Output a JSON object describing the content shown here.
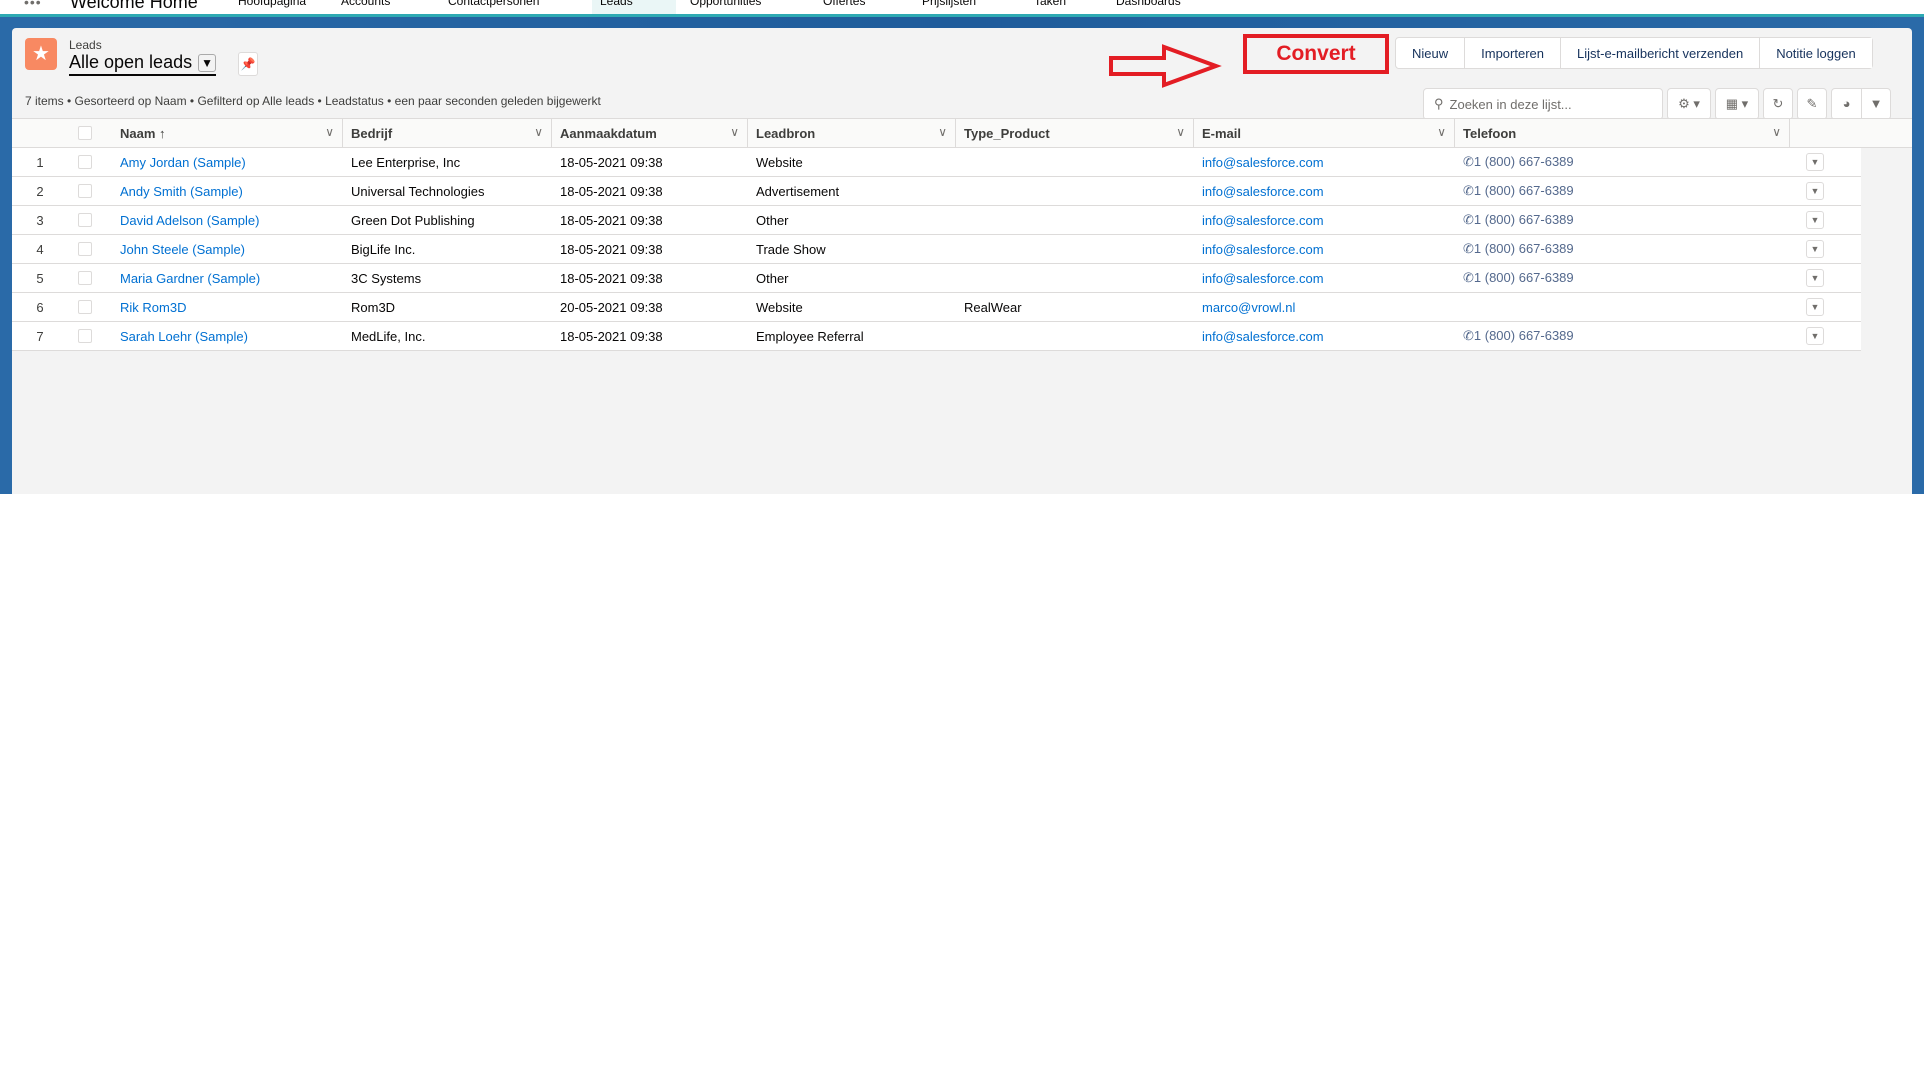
{
  "nav": {
    "app_name": "Welcome Home",
    "tabs": [
      "Hoofdpagina",
      "Accounts",
      "Contactpersonen",
      "Leads",
      "Opportunities",
      "Offertes",
      "Prijslijsten",
      "Taken",
      "Dashboards"
    ]
  },
  "header": {
    "object_label": "Leads",
    "list_title": "Alle open leads",
    "meta": "7 items • Gesorteerd op Naam • Gefilterd op Alle leads • Leadstatus • een paar seconden geleden bijgewerkt"
  },
  "annotation": {
    "convert_label": "Convert"
  },
  "actions": {
    "new": "Nieuw",
    "import": "Importeren",
    "send_email": "Lijst-e-mailbericht verzenden",
    "log_note": "Notitie loggen"
  },
  "search": {
    "placeholder": "Zoeken in deze lijst...",
    "value": ""
  },
  "columns": [
    "Naam",
    "Bedrijf",
    "Aanmaakdatum",
    "Leadbron",
    "Type_Product",
    "E-mail",
    "Telefoon"
  ],
  "sort_indicator": "↑",
  "rows": [
    {
      "n": "1",
      "name": "Amy Jordan (Sample)",
      "company": "Lee Enterprise, Inc",
      "date": "18-05-2021 09:38",
      "source": "Website",
      "type": "",
      "email": "info@salesforce.com",
      "phone": "1 (800) 667-6389"
    },
    {
      "n": "2",
      "name": "Andy Smith (Sample)",
      "company": "Universal Technologies",
      "date": "18-05-2021 09:38",
      "source": "Advertisement",
      "type": "",
      "email": "info@salesforce.com",
      "phone": "1 (800) 667-6389"
    },
    {
      "n": "3",
      "name": "David Adelson (Sample)",
      "company": "Green Dot Publishing",
      "date": "18-05-2021 09:38",
      "source": "Other",
      "type": "",
      "email": "info@salesforce.com",
      "phone": "1 (800) 667-6389"
    },
    {
      "n": "4",
      "name": "John Steele (Sample)",
      "company": "BigLife Inc.",
      "date": "18-05-2021 09:38",
      "source": "Trade Show",
      "type": "",
      "email": "info@salesforce.com",
      "phone": "1 (800) 667-6389"
    },
    {
      "n": "5",
      "name": "Maria Gardner (Sample)",
      "company": "3C Systems",
      "date": "18-05-2021 09:38",
      "source": "Other",
      "type": "",
      "email": "info@salesforce.com",
      "phone": "1 (800) 667-6389"
    },
    {
      "n": "6",
      "name": "Rik Rom3D",
      "company": "Rom3D",
      "date": "20-05-2021 09:38",
      "source": "Website",
      "type": "RealWear",
      "email": "marco@vrowl.nl",
      "phone": ""
    },
    {
      "n": "7",
      "name": "Sarah Loehr (Sample)",
      "company": "MedLife, Inc.",
      "date": "18-05-2021 09:38",
      "source": "Employee Referral",
      "type": "",
      "email": "info@salesforce.com",
      "phone": "1 (800) 667-6389"
    }
  ]
}
